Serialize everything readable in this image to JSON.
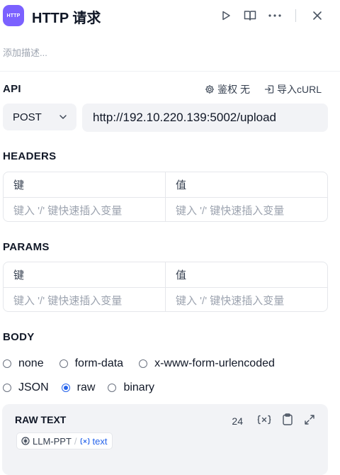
{
  "header": {
    "app_icon_text": "HTTP",
    "title": "HTTP 请求",
    "actions": [
      "play-icon",
      "book-open-icon",
      "more-icon",
      "close-icon"
    ]
  },
  "description_placeholder": "添加描述...",
  "api": {
    "title": "API",
    "auth_label": "鉴权 无",
    "import_label": "导入cURL",
    "method": "POST",
    "url": "http://192.10.220.139:5002/upload"
  },
  "headers": {
    "title": "HEADERS",
    "key_header": "键",
    "value_header": "值",
    "key_placeholder": "键入 '/' 键快速插入变量",
    "value_placeholder": "键入 '/' 键快速插入变量"
  },
  "params": {
    "title": "PARAMS",
    "key_header": "键",
    "value_header": "值",
    "key_placeholder": "键入 '/' 键快速插入变量",
    "value_placeholder": "键入 '/' 键快速插入变量"
  },
  "body": {
    "title": "BODY",
    "options_row1": [
      "none",
      "form-data",
      "x-www-form-urlencoded"
    ],
    "options_row2": [
      "JSON",
      "raw",
      "binary"
    ],
    "selected": "raw"
  },
  "raw_text": {
    "title": "RAW TEXT",
    "count": "24",
    "variable_source": "LLM-PPT",
    "variable_name": "text"
  },
  "colors": {
    "accent": "#2563eb",
    "icon_bg": "#7b61ff"
  }
}
